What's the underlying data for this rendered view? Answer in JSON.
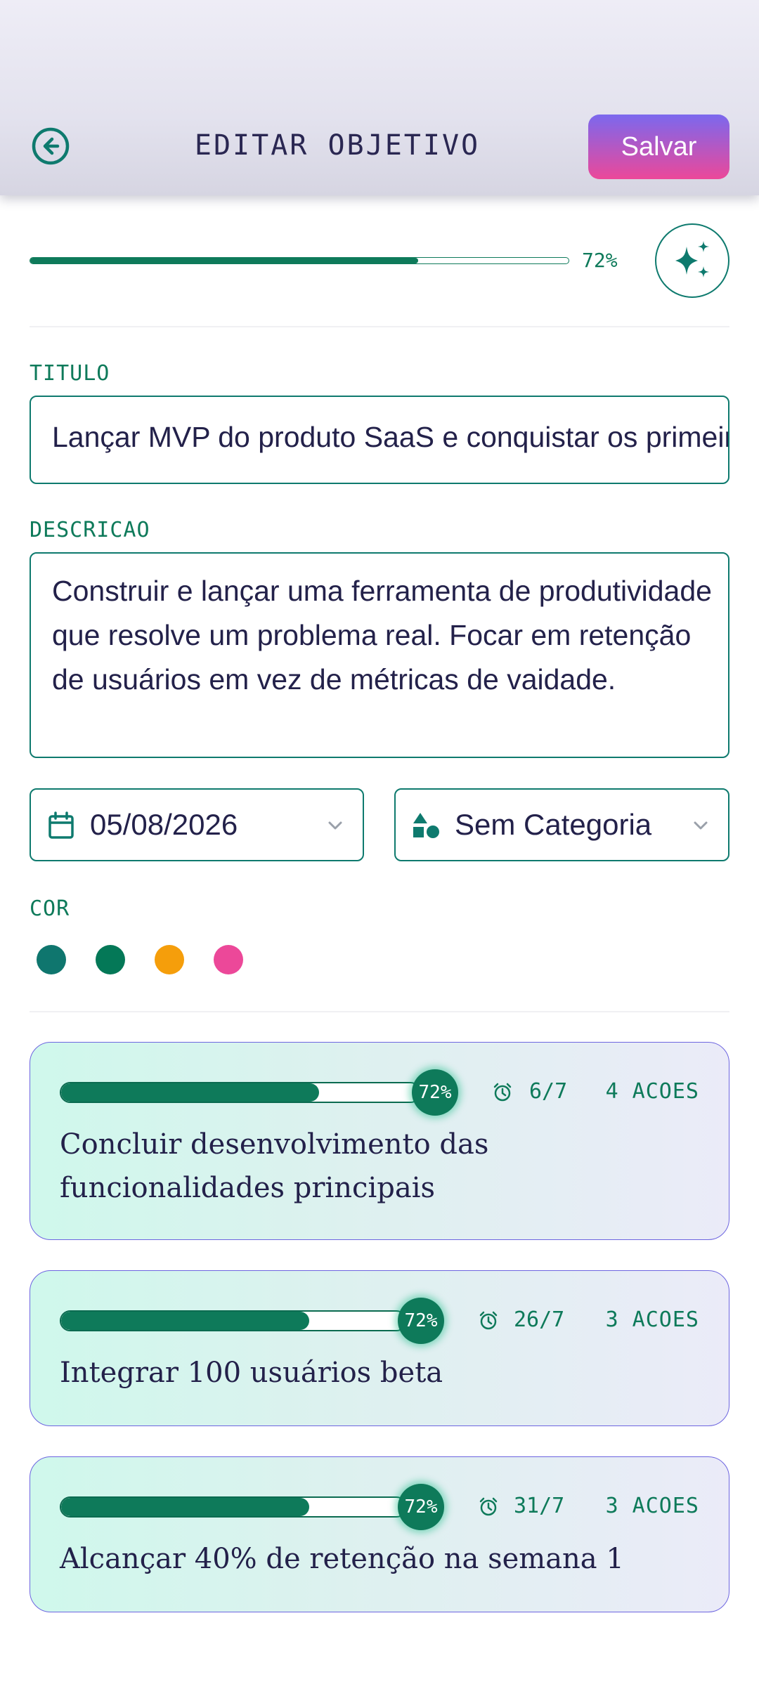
{
  "header": {
    "title": "EDITAR OBJETIVO",
    "save_label": "Salvar",
    "back_icon": "arrow-left-circle-icon"
  },
  "progress": {
    "percent": 72,
    "label": "72%",
    "ai_icon": "sparkles-icon"
  },
  "form": {
    "title_label": "TITULO",
    "title_value": "Lançar MVP do produto SaaS e conquistar os primeiros usuários",
    "description_label": "DESCRICAO",
    "description_value": "Construir e lançar uma ferramenta de produtividade que resolve um problema real. Focar em retenção de usuários em vez de métricas de vaidade.",
    "date_value": "05/08/2026",
    "category_value": "Sem Categoria",
    "color_label": "COR",
    "colors": [
      "#0f766e",
      "#047857",
      "#f59e0b",
      "#ec4899"
    ]
  },
  "tasks": [
    {
      "progress": 0.72,
      "badge": "72%",
      "date": "6/7",
      "actions": "4 ACOES",
      "title": "Concluir desenvolvimento das funcionalidades principais"
    },
    {
      "progress": 0.72,
      "badge": "72%",
      "date": "26/7",
      "actions": "3 ACOES",
      "title": "Integrar 100 usuários beta"
    },
    {
      "progress": 0.72,
      "badge": "72%",
      "date": "31/7",
      "actions": "3 ACOES",
      "title": "Alcançar 40% de retenção na semana 1"
    }
  ],
  "colors": {
    "primary": "#0e7a5a",
    "accent_gradient": [
      "#7b68ee",
      "#ec4899"
    ],
    "text": "#23214a"
  }
}
